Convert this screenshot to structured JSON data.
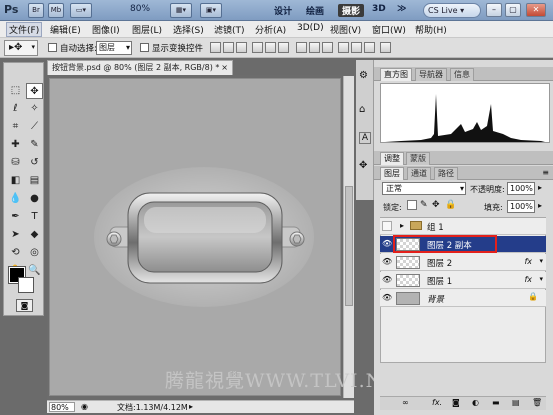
{
  "app": {
    "logo": "Ps",
    "title_buttons": [
      "Br",
      "Mb"
    ],
    "zoom": "80%",
    "workspaces": [
      "设计",
      "绘画",
      "摄影",
      "3D"
    ],
    "active_workspace": "摄影",
    "more": "≫",
    "cslive": "CS Live",
    "window_controls": [
      "–",
      "▢",
      "✕"
    ]
  },
  "menu": [
    "文件(F)",
    "编辑(E)",
    "图像(I)",
    "图层(L)",
    "选择(S)",
    "滤镜(T)",
    "分析(A)",
    "3D(D)",
    "视图(V)",
    "窗口(W)",
    "帮助(H)"
  ],
  "options": {
    "auto_select_label": "自动选择:",
    "auto_select_value": "图层",
    "show_transform_label": "显示变换控件"
  },
  "document": {
    "tab_title": "按钮背景.psd @ 80% (图层 2 副本, RGB/8) *",
    "zoom": "80%",
    "doc_size": "文档:1.13M/4.12M"
  },
  "histogram": {
    "tabs": [
      "直方图",
      "导航器",
      "信息"
    ]
  },
  "adjust": {
    "tabs": [
      "调整",
      "蒙版"
    ]
  },
  "layers": {
    "tabs": [
      "图层",
      "通道",
      "路径"
    ],
    "blend_mode": "正常",
    "opacity_label": "不透明度:",
    "opacity": "100%",
    "lock_label": "锁定:",
    "fill_label": "填充:",
    "fill": "100%",
    "items": [
      {
        "name": "组 1",
        "type": "group"
      },
      {
        "name": "图层 2 副本",
        "type": "layer",
        "selected": true
      },
      {
        "name": "图层 2",
        "type": "layer",
        "fx": "fx"
      },
      {
        "name": "图层 1",
        "type": "layer",
        "fx": "fx"
      },
      {
        "name": "背景",
        "type": "background"
      }
    ]
  },
  "watermark": "腾龍視覺WWW.TLVI.NET",
  "colors": {
    "selected_layer": "#243d8a",
    "highlight_border": "#e3201b"
  }
}
